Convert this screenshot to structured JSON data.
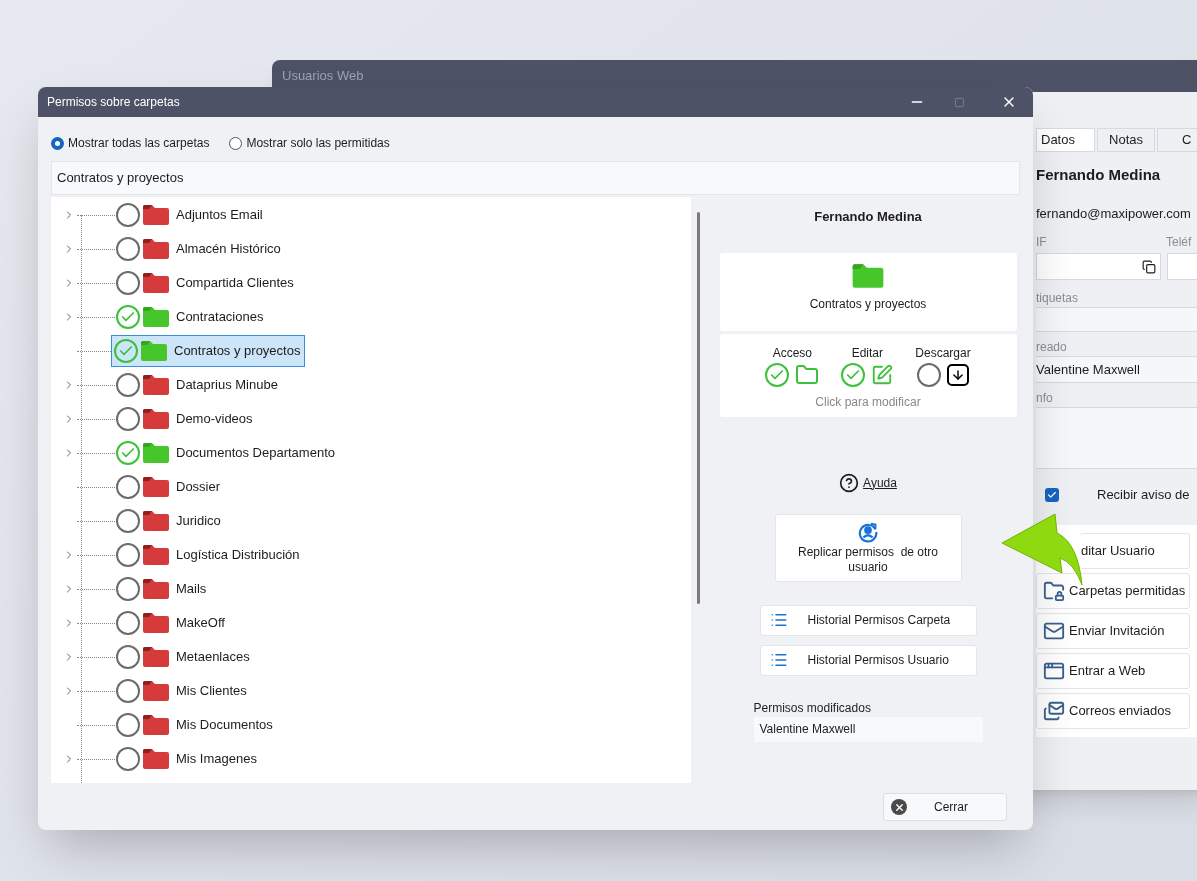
{
  "back_window": {
    "title": "Usuarios Web",
    "tabs": [
      {
        "label": "Datos",
        "selected": true
      },
      {
        "label": "Notas",
        "selected": false
      },
      {
        "label": "C",
        "selected": false
      }
    ],
    "user_name": "Fernando Medina",
    "email": "fernando@maxipower.com",
    "nif_label": "IF",
    "phone_label": "Teléf",
    "tags_label": "tiquetas",
    "created_label": "reado",
    "created_value": "Valentine Maxwell",
    "info_label": "nfo",
    "notify": {
      "label": "Recibir aviso de",
      "checked": true
    },
    "actions": [
      {
        "kind": "edit",
        "label": "ditar Usuario"
      },
      {
        "kind": "folder",
        "label": "Carpetas permitidas"
      },
      {
        "kind": "invite",
        "label": "Enviar Invitación"
      },
      {
        "kind": "web",
        "label": "Entrar a Web"
      },
      {
        "kind": "sent",
        "label": "Correos enviados"
      }
    ]
  },
  "window": {
    "title": "Permisos sobre carpetas"
  },
  "filter": [
    {
      "label": "Mostrar todas las carpetas",
      "selected": true
    },
    {
      "label": "Mostrar solo las permitidas",
      "selected": false
    }
  ],
  "path": "Contratos y proyectos",
  "folders": [
    {
      "name": "Adjuntos Email",
      "expandable": true,
      "checked": false,
      "selected": false
    },
    {
      "name": "Almacén Histórico",
      "expandable": true,
      "checked": false,
      "selected": false
    },
    {
      "name": "Compartida Clientes",
      "expandable": true,
      "checked": false,
      "selected": false
    },
    {
      "name": "Contrataciones",
      "expandable": true,
      "checked": true,
      "selected": false
    },
    {
      "name": "Contratos y proyectos",
      "expandable": false,
      "checked": true,
      "selected": true
    },
    {
      "name": "Dataprius Minube",
      "expandable": true,
      "checked": false,
      "selected": false
    },
    {
      "name": "Demo-videos",
      "expandable": true,
      "checked": false,
      "selected": false
    },
    {
      "name": "Documentos Departamento",
      "expandable": true,
      "checked": true,
      "selected": false
    },
    {
      "name": "Dossier",
      "expandable": false,
      "checked": false,
      "selected": false
    },
    {
      "name": "Juridico",
      "expandable": false,
      "checked": false,
      "selected": false
    },
    {
      "name": "Logística Distribución",
      "expandable": true,
      "checked": false,
      "selected": false
    },
    {
      "name": "Mails",
      "expandable": true,
      "checked": false,
      "selected": false
    },
    {
      "name": "MakeOff",
      "expandable": true,
      "checked": false,
      "selected": false
    },
    {
      "name": "Metaenlaces",
      "expandable": true,
      "checked": false,
      "selected": false
    },
    {
      "name": "Mis Clientes",
      "expandable": true,
      "checked": false,
      "selected": false
    },
    {
      "name": "Mis Documentos",
      "expandable": false,
      "checked": false,
      "selected": false
    },
    {
      "name": "Mis Imagenes",
      "expandable": true,
      "checked": false,
      "selected": false
    }
  ],
  "detail": {
    "user_name": "Fernando Medina",
    "folder_name": "Contratos y proyectos",
    "permissions": [
      {
        "kind": "access",
        "label": "Acceso",
        "checked": true
      },
      {
        "kind": "edit",
        "label": "Editar",
        "checked": true
      },
      {
        "kind": "download",
        "label": "Descargar",
        "checked": false
      }
    ],
    "hint": "Click para modificar",
    "help": "Ayuda",
    "replicate": "Replicar permisos  de otro usuario",
    "history": [
      "Historial Permisos Carpeta",
      "Historial Permisos Usuario"
    ],
    "modified_label": "Permisos modificados",
    "modified_value": "Valentine Maxwell"
  },
  "close_button": "Cerrar"
}
